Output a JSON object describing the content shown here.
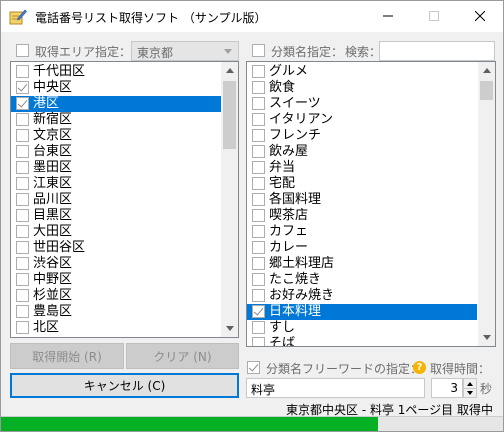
{
  "window": {
    "title": "電話番号リスト取得ソフト （サンプル版）"
  },
  "area": {
    "checkbox_label": "取得エリア指定：",
    "checked": false,
    "selected": "東京都"
  },
  "category": {
    "checkbox_label": "分類名指定：",
    "checked": false,
    "search_label": "検索：",
    "search_value": ""
  },
  "wards": [
    {
      "label": "千代田区",
      "checked": false,
      "selected": false
    },
    {
      "label": "中央区",
      "checked": true,
      "selected": false
    },
    {
      "label": "港区",
      "checked": true,
      "selected": true
    },
    {
      "label": "新宿区",
      "checked": false,
      "selected": false
    },
    {
      "label": "文京区",
      "checked": false,
      "selected": false
    },
    {
      "label": "台東区",
      "checked": false,
      "selected": false
    },
    {
      "label": "墨田区",
      "checked": false,
      "selected": false
    },
    {
      "label": "江東区",
      "checked": false,
      "selected": false
    },
    {
      "label": "品川区",
      "checked": false,
      "selected": false
    },
    {
      "label": "目黒区",
      "checked": false,
      "selected": false
    },
    {
      "label": "大田区",
      "checked": false,
      "selected": false
    },
    {
      "label": "世田谷区",
      "checked": false,
      "selected": false
    },
    {
      "label": "渋谷区",
      "checked": false,
      "selected": false
    },
    {
      "label": "中野区",
      "checked": false,
      "selected": false
    },
    {
      "label": "杉並区",
      "checked": false,
      "selected": false
    },
    {
      "label": "豊島区",
      "checked": false,
      "selected": false
    },
    {
      "label": "北区",
      "checked": false,
      "selected": false
    }
  ],
  "categories": [
    {
      "label": "グルメ",
      "checked": false,
      "selected": false
    },
    {
      "label": "飲食",
      "checked": false,
      "selected": false
    },
    {
      "label": "スイーツ",
      "checked": false,
      "selected": false
    },
    {
      "label": "イタリアン",
      "checked": false,
      "selected": false
    },
    {
      "label": "フレンチ",
      "checked": false,
      "selected": false
    },
    {
      "label": "飲み屋",
      "checked": false,
      "selected": false
    },
    {
      "label": "弁当",
      "checked": false,
      "selected": false
    },
    {
      "label": "宅配",
      "checked": false,
      "selected": false
    },
    {
      "label": "各国料理",
      "checked": false,
      "selected": false
    },
    {
      "label": "喫茶店",
      "checked": false,
      "selected": false
    },
    {
      "label": "カフェ",
      "checked": false,
      "selected": false
    },
    {
      "label": "カレー",
      "checked": false,
      "selected": false
    },
    {
      "label": "郷土料理店",
      "checked": false,
      "selected": false
    },
    {
      "label": "たこ焼き",
      "checked": false,
      "selected": false
    },
    {
      "label": "お好み焼き",
      "checked": false,
      "selected": false
    },
    {
      "label": "日本料理",
      "checked": true,
      "selected": true
    },
    {
      "label": "すし",
      "checked": false,
      "selected": false
    },
    {
      "label": "そば",
      "checked": false,
      "selected": false
    }
  ],
  "buttons": {
    "start": "取得開始 (R)",
    "clear": "クリア (N)",
    "cancel": "キャンセル (C)"
  },
  "freeword": {
    "checkbox_label": "分類名フリーワードの指定：",
    "checked": true,
    "value": "料亭",
    "help_glyph": "?"
  },
  "interval": {
    "label": "取得時間：",
    "value": "3",
    "unit": "秒"
  },
  "status": {
    "text": "東京都中央区 - 料亭 1ページ目 取得中",
    "progress": 0.75
  },
  "icons": {
    "app": "notepad-pencil-icon",
    "minimize": "minimize-icon",
    "maximize": "maximize-icon",
    "close": "close-icon"
  },
  "colors": {
    "selection": "#0078d7",
    "progress": "#06b025",
    "help_icon": "#f4b400"
  }
}
